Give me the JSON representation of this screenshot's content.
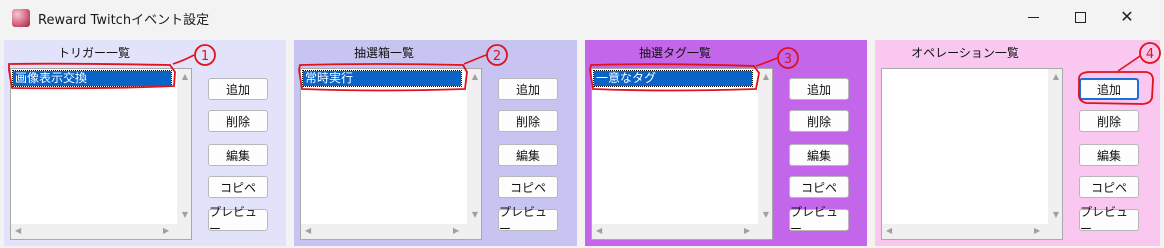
{
  "window": {
    "title": "Reward Twitchイベント設定",
    "controls": {
      "minimize": "—",
      "maximize": "☐",
      "close": "✕"
    }
  },
  "icons": {
    "app": "reward-app-icon",
    "scroll_up": "▲",
    "scroll_down": "▼",
    "scroll_left": "◀",
    "scroll_right": "▶"
  },
  "colors": {
    "panel_trigger": "#e2e3fa",
    "panel_lottery_box": "#c7c4f1",
    "panel_lottery_tag": "#c466ea",
    "panel_operation": "#f9c7ef",
    "selection": "#0a64c8",
    "annotation": "#e0121b"
  },
  "panels": [
    {
      "title": "トリガー一覧",
      "items": [
        "画像表示交換"
      ],
      "buttons": [
        "追加",
        "削除",
        "編集",
        "コピペ",
        "プレビュー"
      ],
      "annotation": "1"
    },
    {
      "title": "抽選箱一覧",
      "items": [
        "常時実行"
      ],
      "buttons": [
        "追加",
        "削除",
        "編集",
        "コピペ",
        "プレビュー"
      ],
      "annotation": "2"
    },
    {
      "title": "抽選タグ一覧",
      "items": [
        "一意なタグ"
      ],
      "buttons": [
        "追加",
        "削除",
        "編集",
        "コピペ",
        "プレビュー"
      ],
      "annotation": "3"
    },
    {
      "title": "オペレーション一覧",
      "items": [],
      "buttons": [
        "追加",
        "削除",
        "編集",
        "コピペ",
        "プレビュー"
      ],
      "annotation": "4"
    }
  ]
}
